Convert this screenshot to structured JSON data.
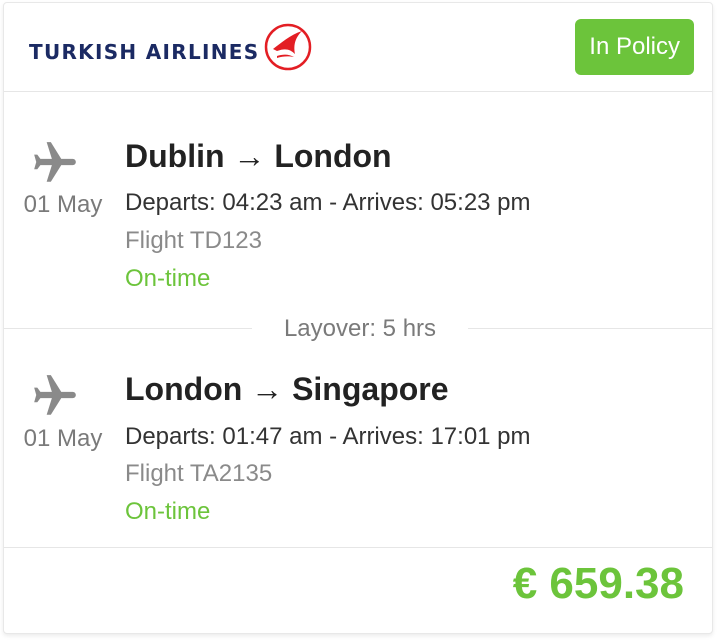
{
  "airline": {
    "name": "TURKISH AIRLINES",
    "logo_icon": "turkish-airlines-bird-icon",
    "brand_color": "#1b2a63",
    "emblem_color": "#e31e24"
  },
  "badge": {
    "label": "In Policy",
    "color": "#6cc43b"
  },
  "segments": [
    {
      "icon": "airplane-icon",
      "date": "01 May",
      "route": "Dublin → London",
      "times": "Departs: 04:23 am - Arrives: 05:23 pm",
      "flight": "Flight TD123",
      "status": "On-time"
    },
    {
      "icon": "airplane-icon",
      "date": "01 May",
      "route": "London → Singapore",
      "times": "Departs: 01:47 am - Arrives: 17:01 pm",
      "flight": "Flight TA2135",
      "status": "On-time"
    }
  ],
  "layover": "Layover: 5 hrs",
  "price": "€ 659.38",
  "colors": {
    "accent": "#6cc43b",
    "muted": "#7a7a7a"
  }
}
